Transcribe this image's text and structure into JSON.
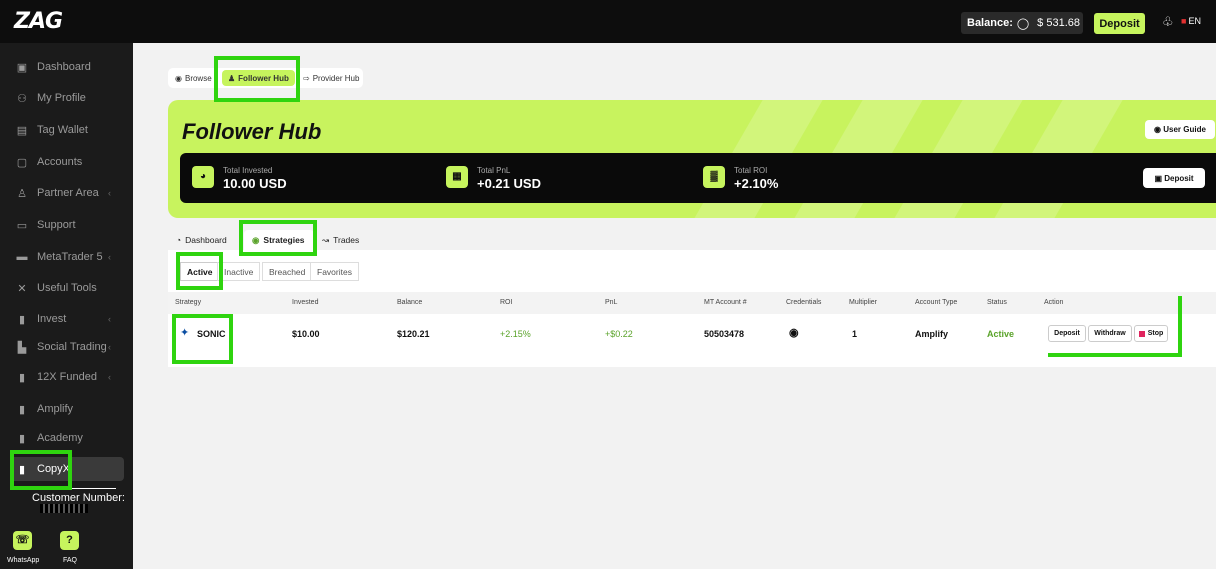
{
  "topbar": {
    "logo": "ZAG",
    "balance_label": "Balance:",
    "balance_value": "$ 531.68",
    "deposit_label": "Deposit",
    "lang": "EN"
  },
  "sidebar": {
    "items": [
      {
        "label": "Dashboard",
        "icon": "dashboard-icon",
        "glyph": "▣"
      },
      {
        "label": "My Profile",
        "icon": "user-icon",
        "glyph": "⚇"
      },
      {
        "label": "Tag Wallet",
        "icon": "wallet-icon",
        "glyph": "▤"
      },
      {
        "label": "Accounts",
        "icon": "accounts-icon",
        "glyph": "▢"
      },
      {
        "label": "Partner Area",
        "icon": "partner-icon",
        "glyph": "♙"
      },
      {
        "label": "Support",
        "icon": "support-icon",
        "glyph": "▭"
      },
      {
        "label": "MetaTrader 5",
        "icon": "monitor-icon",
        "glyph": "▬"
      },
      {
        "label": "Useful Tools",
        "icon": "tools-icon",
        "glyph": "✕"
      },
      {
        "label": "Invest",
        "icon": "bars-icon",
        "glyph": "▮"
      },
      {
        "label": "Social Trading",
        "icon": "social-icon",
        "glyph": "▙"
      },
      {
        "label": "12X Funded",
        "icon": "bars-icon",
        "glyph": "▮"
      },
      {
        "label": "Amplify",
        "icon": "bars-icon",
        "glyph": "▮"
      },
      {
        "label": "Academy",
        "icon": "bars-icon",
        "glyph": "▮"
      },
      {
        "label": "CopyX",
        "icon": "bars-icon",
        "glyph": "▮"
      }
    ],
    "customer_label": "Customer Number:",
    "whatsapp_label": "WhatsApp",
    "faq_label": "FAQ"
  },
  "hub_tabs": [
    "Browse",
    "Follower Hub",
    "Provider Hub"
  ],
  "hero": {
    "title": "Follower Hub",
    "user_guide": "User Guide",
    "deposit": "Deposit",
    "stats": [
      {
        "label": "Total Invested",
        "value": "10.00 USD"
      },
      {
        "label": "Total PnL",
        "value": "+0.21 USD"
      },
      {
        "label": "Total ROI",
        "value": "+2.10%"
      }
    ]
  },
  "sub_tabs": [
    "Dashboard",
    "Strategies",
    "Trades"
  ],
  "filters": [
    "Active",
    "Inactive",
    "Breached",
    "Favorites"
  ],
  "table": {
    "columns": [
      "Strategy",
      "Invested",
      "Balance",
      "ROI",
      "PnL",
      "MT Account #",
      "Credentials",
      "Multiplier",
      "Account Type",
      "Status",
      "Action"
    ],
    "row": {
      "strategy": "SONIC",
      "invested": "$10.00",
      "balance": "$120.21",
      "roi": "+2.15%",
      "pnl": "+$0.22",
      "mt_account": "50503478",
      "multiplier": "1",
      "account_type": "Amplify",
      "status": "Active"
    },
    "actions": {
      "deposit": "Deposit",
      "withdraw": "Withdraw",
      "stop": "Stop"
    }
  },
  "colors": {
    "accent": "#c6f45d",
    "annotation": "#2fd40f",
    "status": "#5aa32a"
  }
}
